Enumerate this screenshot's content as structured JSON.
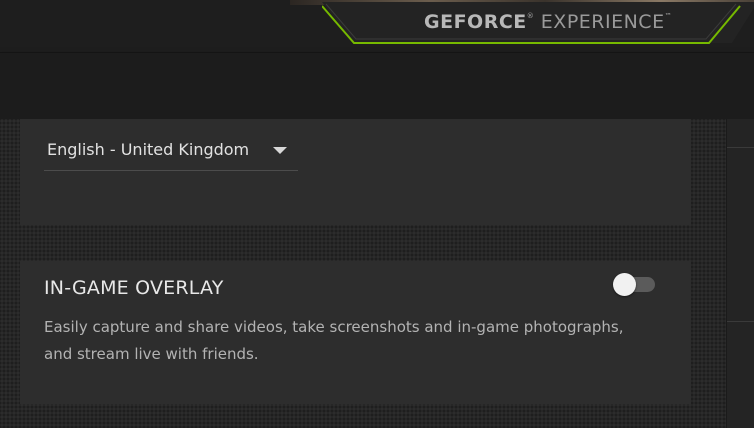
{
  "header": {
    "brand_bold": "GEFORCE",
    "brand_mark": "®",
    "brand_light": " EXPERIENCE",
    "brand_tm": "™",
    "accent_color": "#76b900"
  },
  "language": {
    "selected": "English - United Kingdom"
  },
  "in_game_overlay": {
    "title": "IN-GAME OVERLAY",
    "description": "Easily capture and share videos, take screenshots and in-game photographs, and stream live with friends.",
    "enabled": false
  }
}
